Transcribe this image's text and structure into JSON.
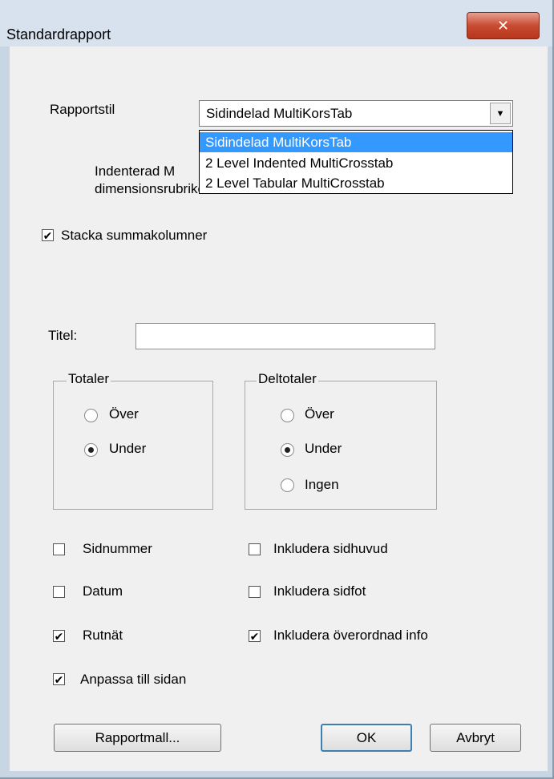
{
  "window": {
    "title": "Standardrapport",
    "close_glyph": "✕"
  },
  "report_style": {
    "label": "Rapportstil",
    "selected": "Sidindelad MultiKorsTab",
    "options": [
      "Sidindelad MultiKorsTab",
      "2 Level Indented MultiCrosstab",
      "2 Level Tabular MultiCrosstab"
    ],
    "arrow_glyph": "▼"
  },
  "description": {
    "line1": "Indenterad M",
    "line2": "dimensionsrubriker."
  },
  "stack_checkbox": {
    "label": "Stacka summakolumner",
    "checked": true
  },
  "title_field": {
    "label": "Titel:",
    "value": ""
  },
  "totals": {
    "legend": "Totaler",
    "options": [
      {
        "label": "Över",
        "selected": false
      },
      {
        "label": "Under",
        "selected": true
      }
    ]
  },
  "subtotals": {
    "legend": "Deltotaler",
    "options": [
      {
        "label": "Över",
        "selected": false
      },
      {
        "label": "Under",
        "selected": true
      },
      {
        "label": "Ingen",
        "selected": false
      }
    ]
  },
  "checkboxes": {
    "page_number": {
      "label": "Sidnummer",
      "checked": false
    },
    "date": {
      "label": "Datum",
      "checked": false
    },
    "grid": {
      "label": "Rutnät",
      "checked": true
    },
    "fit_page": {
      "label": "Anpassa till sidan",
      "checked": true
    },
    "header": {
      "label": "Inkludera sidhuvud",
      "checked": false
    },
    "footer": {
      "label": "Inkludera sidfot",
      "checked": false
    },
    "parent_info": {
      "label": "Inkludera överordnad info",
      "checked": true
    }
  },
  "buttons": {
    "template": "Rapportmall...",
    "ok": "OK",
    "cancel": "Avbryt"
  },
  "check_glyph": "✔"
}
